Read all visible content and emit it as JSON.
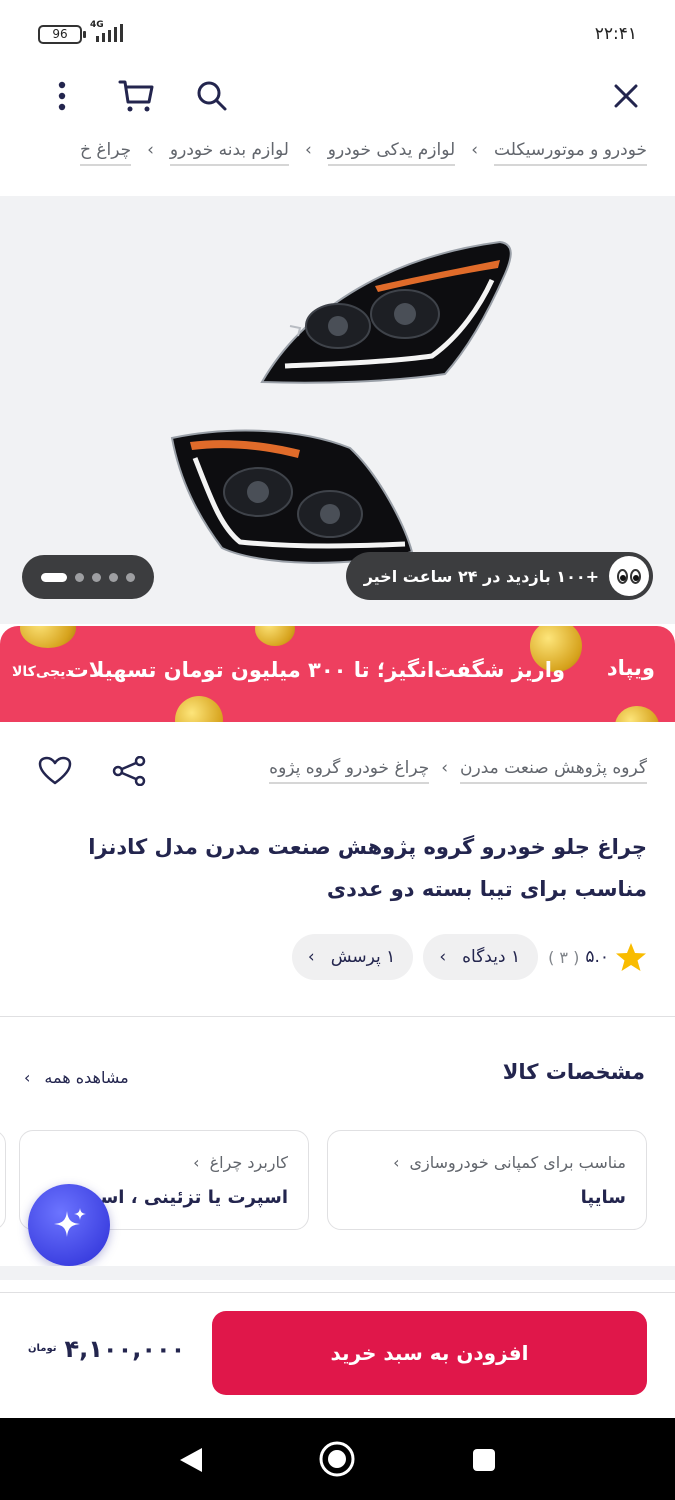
{
  "status_bar": {
    "time": "۲۲:۴۱",
    "battery": "96",
    "network": "4G"
  },
  "toolbar": {
    "icons": [
      "close-icon",
      "search-icon",
      "cart-icon",
      "more-vertical-icon"
    ]
  },
  "breadcrumb": {
    "items": [
      "خودرو و موتورسیکلت",
      "لوازم یدکی خودرو",
      "لوازم بدنه خودرو",
      "چراغ خ"
    ]
  },
  "gallery": {
    "views_text": "+۱۰۰ بازدید در ۲۴ ساعت اخیر",
    "dot_count": 5,
    "active_dot": 0
  },
  "banner": {
    "wallet": "ویپاد",
    "text": "واریز شگفت‌انگیز؛ تا ۳۰۰ میلیون تومان تسهیلات",
    "brand": "دیجی‌کالا",
    "color": "#ee3f5f"
  },
  "product": {
    "brand": "گروه پژوهش صنعت مدرن",
    "category": "چراغ خودرو گروه پژوه",
    "title": "چراغ جلو خودرو گروه پژوهش صنعت مدرن مدل کادنزا مناسب برای تیبا بسته دو عددی",
    "rating": "۵.۰",
    "rating_count": "( ۳ )",
    "reviews_chip": "۱ دیدگاه",
    "questions_chip": "۱ پرسش"
  },
  "specs": {
    "title": "مشخصات کالا",
    "see_all": "مشاهده همه",
    "cards": [
      {
        "label": "مناسب برای کمپانی خودروسازی",
        "value": "سایپا"
      },
      {
        "label": "کاربرد چراغ",
        "value": "اسپرت یا تزئینی ، اسپ"
      }
    ]
  },
  "buy": {
    "button": "افزودن به سبد خرید",
    "price": "۴,۱۰۰,۰۰۰",
    "currency": "تومان",
    "accent": "#e0174a"
  }
}
